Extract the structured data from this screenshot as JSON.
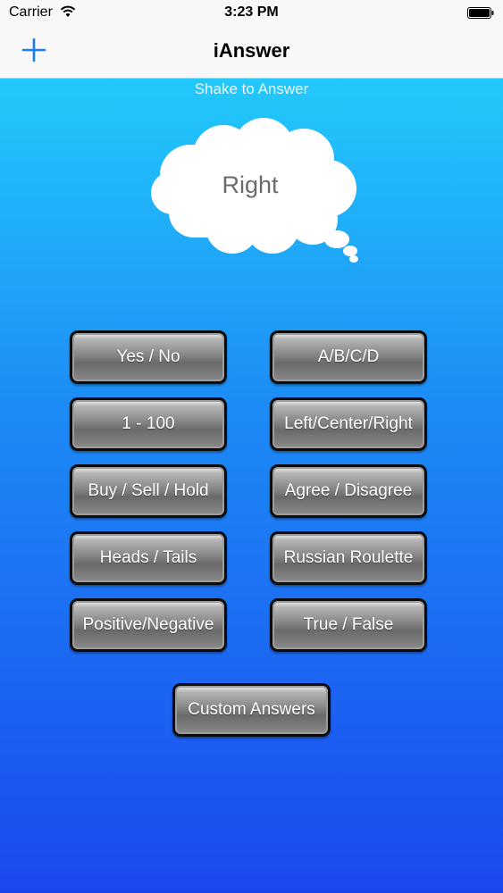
{
  "status_bar": {
    "carrier": "Carrier",
    "time": "3:23 PM"
  },
  "nav": {
    "title": "iAnswer"
  },
  "hint": "Shake to Answer",
  "answer": "Right",
  "buttons": {
    "yes_no": "Yes / No",
    "abcd": "A/B/C/D",
    "one_hundred": "1 - 100",
    "left_center_right": "Left/Center/Right",
    "buy_sell_hold": "Buy / Sell / Hold",
    "agree_disagree": "Agree / Disagree",
    "heads_tails": "Heads / Tails",
    "russian_roulette": "Russian Roulette",
    "positive_negative": "Positive/Negative",
    "true_false": "True / False",
    "custom_answers": "Custom Answers"
  },
  "colors": {
    "accent": "#1a7cf5",
    "background_top": "#22c9fb",
    "background_bottom": "#1a48ef"
  }
}
